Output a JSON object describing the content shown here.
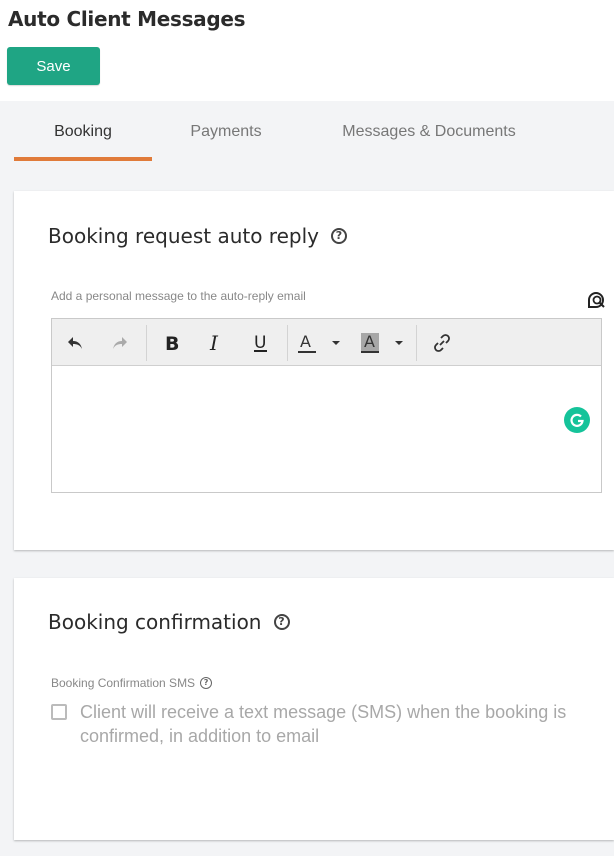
{
  "header": {
    "title": "Auto Client Messages",
    "save_label": "Save"
  },
  "tabs": [
    {
      "label": "Booking",
      "active": true
    },
    {
      "label": "Payments",
      "active": false
    },
    {
      "label": "Messages & Documents",
      "active": false
    }
  ],
  "booking_request": {
    "title": "Booking request auto reply",
    "help_glyph": "?",
    "field_label": "Add a personal message to the auto-reply email",
    "editor_value": "",
    "toolbar": [
      "undo-icon",
      "redo-icon",
      "bold-icon",
      "italic-icon",
      "underline-icon",
      "text-color-icon",
      "highlight-color-icon",
      "link-icon"
    ]
  },
  "booking_confirmation": {
    "title": "Booking confirmation",
    "help_glyph": "?",
    "field_label": "Booking Confirmation SMS",
    "checkbox_label": "Client will receive a text message (SMS) when the booking is confirmed, in addition to email",
    "checked": false
  },
  "colors": {
    "accent": "#1fa584",
    "tab_underline": "#e07b3a",
    "grammarly": "#15c39a",
    "background": "#f3f4f6"
  }
}
